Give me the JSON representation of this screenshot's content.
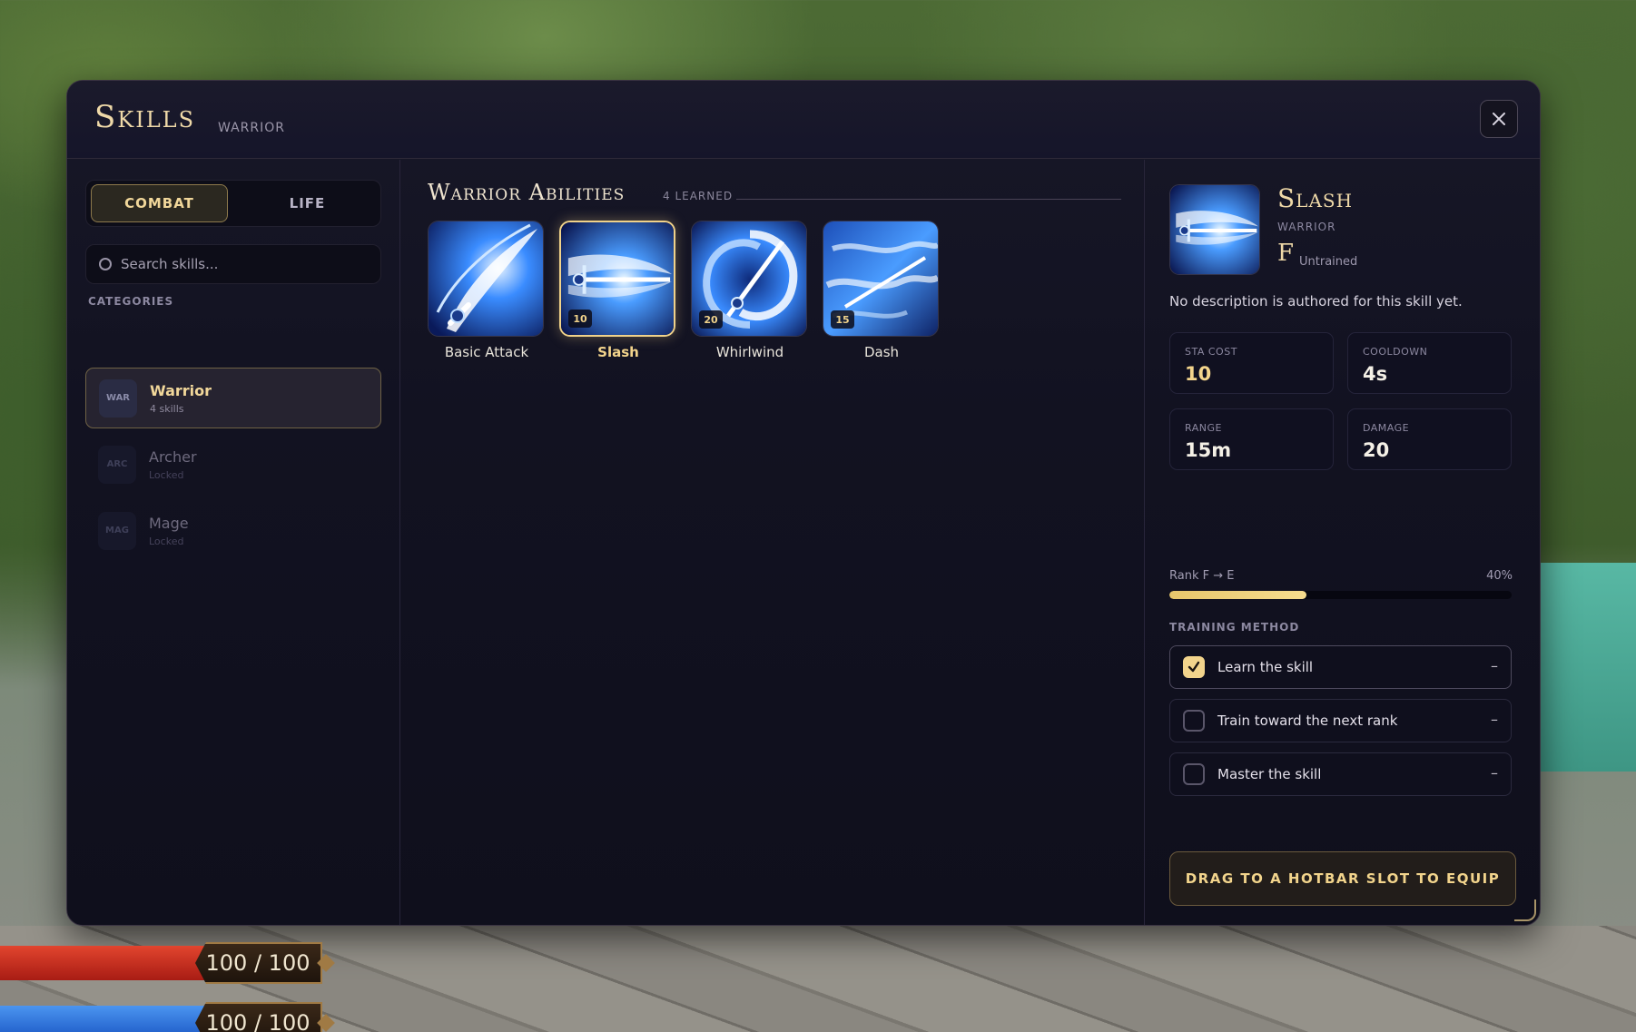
{
  "modal": {
    "title": "Skills",
    "subtitle": "WARRIOR"
  },
  "tabs": {
    "combat": "COMBAT",
    "life": "LIFE"
  },
  "search": {
    "placeholder": "Search skills..."
  },
  "categories": {
    "label": "CATEGORIES",
    "items": [
      {
        "abbr": "WAR",
        "name": "Warrior",
        "sub": "4 skills",
        "state": "active"
      },
      {
        "abbr": "ARC",
        "name": "Archer",
        "sub": "Locked",
        "state": "locked"
      },
      {
        "abbr": "MAG",
        "name": "Mage",
        "sub": "Locked",
        "state": "locked"
      }
    ]
  },
  "abilities": {
    "title": "Warrior Abilities",
    "count": "4 LEARNED",
    "skills": [
      {
        "name": "Basic Attack",
        "badge": "",
        "icon": "sword-slash-icon"
      },
      {
        "name": "Slash",
        "badge": "10",
        "icon": "sword-swipe-icon",
        "selected": true
      },
      {
        "name": "Whirlwind",
        "badge": "20",
        "icon": "sword-vortex-icon"
      },
      {
        "name": "Dash",
        "badge": "15",
        "icon": "sword-dash-icon"
      }
    ]
  },
  "detail": {
    "name": "Slash",
    "class": "WARRIOR",
    "rank": "F",
    "status": "Untrained",
    "description": "No description is authored for this skill yet.",
    "stats": [
      {
        "label": "STA COST",
        "value": "10",
        "accent": true
      },
      {
        "label": "COOLDOWN",
        "value": "4s",
        "accent": false
      },
      {
        "label": "RANGE",
        "value": "15m",
        "accent": false
      },
      {
        "label": "DAMAGE",
        "value": "20",
        "accent": false
      }
    ],
    "rank_progress_label": "Rank F → E",
    "rank_progress_text": "40%",
    "rank_progress": 0.4,
    "training_label": "TRAINING METHOD",
    "training": [
      {
        "text": "Learn the skill",
        "checked": true,
        "trail": "–"
      },
      {
        "text": "Train toward the next rank",
        "checked": false,
        "trail": "–"
      },
      {
        "text": "Master the skill",
        "checked": false,
        "trail": "–"
      }
    ],
    "equip_label": "DRAG TO A HOTBAR SLOT TO EQUIP"
  },
  "hud": {
    "health": "100 / 100",
    "mana": "100 / 100"
  },
  "colors": {
    "accent_gold": "#f2d48c",
    "panel_bg": "#121221",
    "health_red": "#c62a1e",
    "mana_blue": "#2a6fd6"
  }
}
